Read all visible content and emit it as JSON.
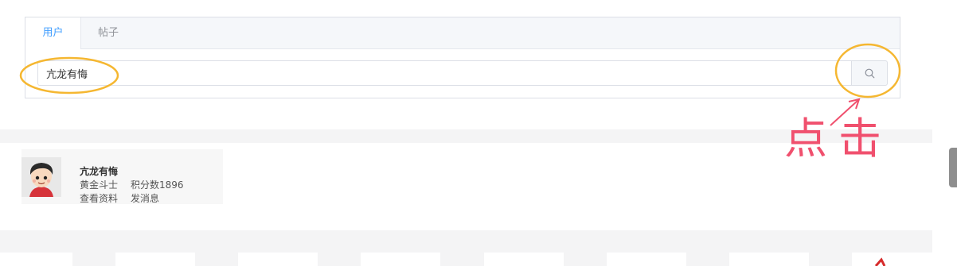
{
  "search": {
    "tabs": [
      {
        "label": "用户",
        "active": true
      },
      {
        "label": "帖子",
        "active": false
      }
    ],
    "query": "亢龙有悔",
    "button_icon": "search-icon"
  },
  "results": [
    {
      "name": "亢龙有悔",
      "level": "黄金斗士",
      "score": "积分数1896",
      "view_profile": "查看资料",
      "send_message": "发消息",
      "avatar_icon": "cartoon-avatar"
    }
  ],
  "annotation": {
    "text": "点击",
    "color": "#f0506e",
    "highlight_color": "#f5b731"
  },
  "colors": {
    "accent": "#409eff",
    "panel_bg": "#f4f4f5"
  }
}
